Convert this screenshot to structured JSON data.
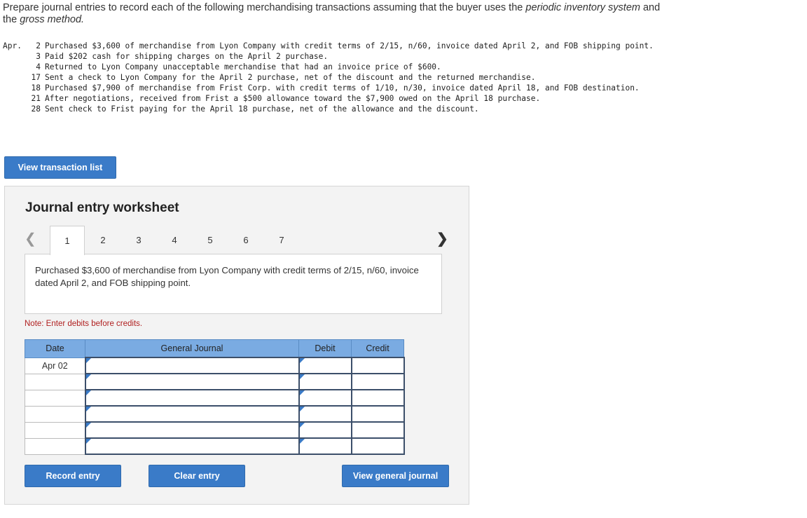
{
  "instructions": {
    "part1": "Prepare journal entries to record each of the following merchandising transactions assuming that the buyer uses the ",
    "em1": "periodic inventory system",
    "part2": " and the ",
    "em2": "gross method.",
    "part3": ""
  },
  "transactions": {
    "month": "Apr.",
    "items": [
      {
        "day": "2",
        "text": "Purchased $3,600 of merchandise from Lyon Company with credit terms of 2/15, n/60, invoice dated April 2, and FOB shipping point."
      },
      {
        "day": "3",
        "text": "Paid $202 cash for shipping charges on the April 2 purchase."
      },
      {
        "day": "4",
        "text": "Returned to Lyon Company unacceptable merchandise that had an invoice price of $600."
      },
      {
        "day": "17",
        "text": "Sent a check to Lyon Company for the April 2 purchase, net of the discount and the returned merchandise."
      },
      {
        "day": "18",
        "text": "Purchased $7,900 of merchandise from Frist Corp. with credit terms of 1/10, n/30, invoice dated April 18, and FOB destination."
      },
      {
        "day": "21",
        "text": "After negotiations, received from Frist a $500 allowance toward the $7,900 owed on the April 18 purchase."
      },
      {
        "day": "28",
        "text": "Sent check to Frist paying for the April 18 purchase, net of the allowance and the discount."
      }
    ]
  },
  "buttons": {
    "view_transaction_list": "View transaction list",
    "record_entry": "Record entry",
    "clear_entry": "Clear entry",
    "view_general_journal": "View general journal"
  },
  "worksheet": {
    "title": "Journal entry worksheet",
    "tabs": [
      "1",
      "2",
      "3",
      "4",
      "5",
      "6",
      "7"
    ],
    "active_tab": "1",
    "description": "Purchased $3,600 of merchandise from Lyon Company with credit terms of 2/15, n/60, invoice dated April 2, and FOB shipping point.",
    "note": "Note: Enter debits before credits."
  },
  "journal": {
    "headers": {
      "date": "Date",
      "general_journal": "General Journal",
      "debit": "Debit",
      "credit": "Credit"
    },
    "rows": [
      {
        "date": "Apr 02",
        "account": "",
        "debit": "",
        "credit": ""
      },
      {
        "date": "",
        "account": "",
        "debit": "",
        "credit": ""
      },
      {
        "date": "",
        "account": "",
        "debit": "",
        "credit": ""
      },
      {
        "date": "",
        "account": "",
        "debit": "",
        "credit": ""
      },
      {
        "date": "",
        "account": "",
        "debit": "",
        "credit": ""
      },
      {
        "date": "",
        "account": "",
        "debit": "",
        "credit": ""
      }
    ]
  },
  "colors": {
    "button_blue": "#3a7bc8",
    "header_blue": "#7aabe2",
    "note_red": "#b02020"
  }
}
